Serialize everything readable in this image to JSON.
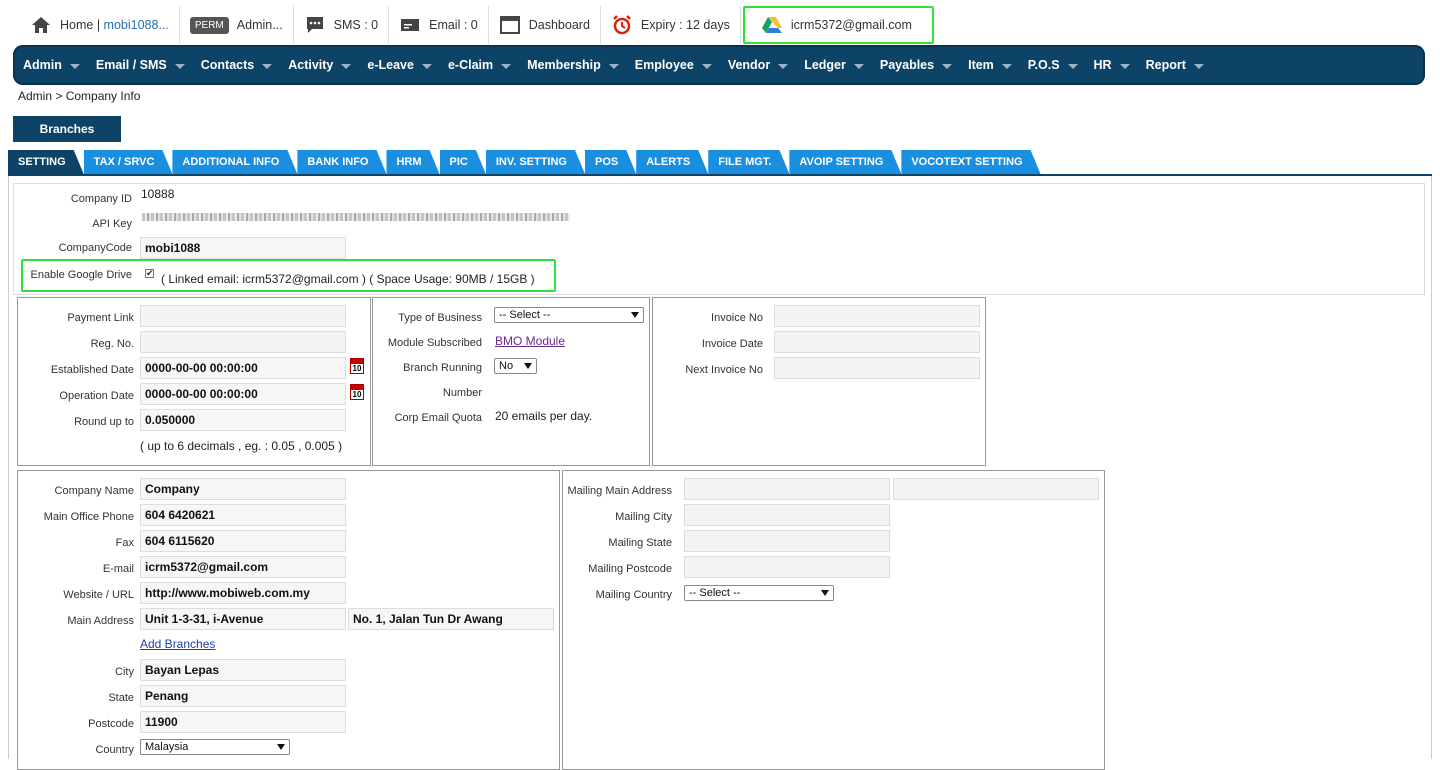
{
  "topbar": {
    "home_label": "Home",
    "home_link": "mobi1088...",
    "perm_badge": "PERM",
    "perm_label": "Admin...",
    "sms_label": "SMS : 0",
    "email_label": "Email : 0",
    "dashboard_label": "Dashboard",
    "expiry_label": "Expiry : 12 days",
    "gdrive_email": "icrm5372@gmail.com"
  },
  "nav": [
    "Admin",
    "Email / SMS",
    "Contacts",
    "Activity",
    "e-Leave",
    "e-Claim",
    "Membership",
    "Employee",
    "Vendor",
    "Ledger",
    "Payables",
    "Item",
    "P.O.S",
    "HR",
    "Report"
  ],
  "breadcrumb": "Admin > Company Info",
  "branches_button": "Branches",
  "tabs": [
    "SETTING",
    "TAX / SRVC",
    "ADDITIONAL INFO",
    "BANK INFO",
    "HRM",
    "PIC",
    "INV. SETTING",
    "POS",
    "ALERTS",
    "FILE MGT.",
    "AVOIP SETTING",
    "VOCOTEXT SETTING"
  ],
  "company": {
    "company_id_label": "Company ID",
    "company_id": "10888",
    "api_key_label": "API Key",
    "company_code_label": "CompanyCode",
    "company_code": "mobi1088",
    "gdrive_label": "Enable Google Drive",
    "gdrive_checkbox": "✔",
    "gdrive_info": "( Linked email: icrm5372@gmail.com ) ( Space Usage: 90MB / 15GB )"
  },
  "panel1": {
    "payment_link_label": "Payment Link",
    "reg_no_label": "Reg. No.",
    "established_label": "Established Date",
    "established_value": "0000-00-00 00:00:00",
    "operation_label": "Operation Date",
    "operation_value": "0000-00-00 00:00:00",
    "round_label": "Round up to",
    "round_value": "0.050000",
    "round_hint": "( up to 6 decimals , eg. : 0.05 , 0.005 )",
    "calendar_text": "10"
  },
  "panel2": {
    "type_label": "Type of Business",
    "type_value": "-- Select --",
    "module_label": "Module Subscribed",
    "module_link": "BMO Module",
    "branch_running_label": "Branch Running",
    "branch_running_value": "No",
    "number_label": "Number",
    "quota_label": "Corp Email Quota",
    "quota_value": "20 emails per day."
  },
  "panel3": {
    "invoice_no_label": "Invoice No",
    "invoice_date_label": "Invoice Date",
    "next_invoice_label": "Next Invoice No"
  },
  "address": {
    "company_name_label": "Company Name",
    "company_name": "Company",
    "phone_label": "Main Office Phone",
    "phone": "604 6420621",
    "fax_label": "Fax",
    "fax": "604 6115620",
    "email_label": "E-mail",
    "email": "icrm5372@gmail.com",
    "website_label": "Website / URL",
    "website": "http://www.mobiweb.com.my",
    "main_address_label": "Main Address",
    "address1": "Unit 1-3-31, i-Avenue",
    "address2": "No. 1, Jalan Tun Dr Awang",
    "add_branches": "Add Branches",
    "city_label": "City",
    "city": "Bayan Lepas",
    "state_label": "State",
    "state": "Penang",
    "postcode_label": "Postcode",
    "postcode": "11900",
    "country_label": "Country",
    "country": "Malaysia"
  },
  "mailing": {
    "main_address_label": "Mailing Main Address",
    "city_label": "Mailing City",
    "state_label": "Mailing State",
    "postcode_label": "Mailing Postcode",
    "country_label": "Mailing Country",
    "country_value": "-- Select --"
  }
}
